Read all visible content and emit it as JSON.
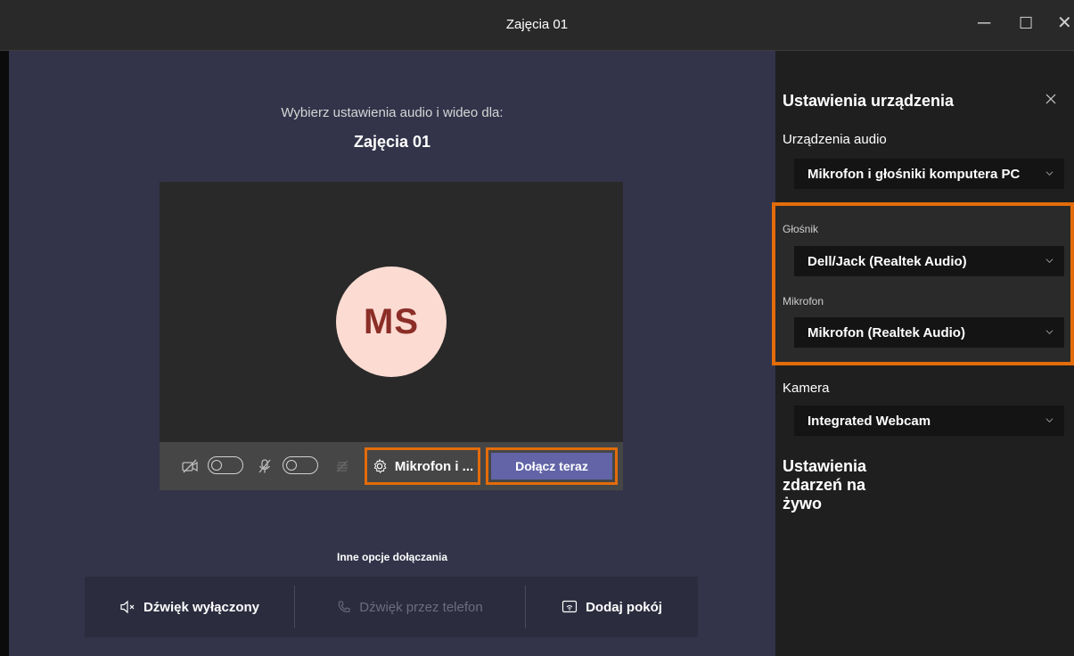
{
  "window": {
    "title": "Zajęcia 01",
    "minimize_glyph": "─",
    "maximize_glyph": "☐",
    "close_glyph": "✕"
  },
  "prejoin": {
    "subtitle": "Wybierz ustawienia audio i wideo dla:",
    "meeting_title": "Zajęcia 01",
    "avatar_initials": "MS",
    "device_button_label": "Mikrofon i ...",
    "join_button_label": "Dołącz teraz"
  },
  "other_options": {
    "label": "Inne opcje dołączania",
    "items": [
      {
        "label": "Dźwięk wyłączony",
        "icon": "speaker-muted-icon",
        "enabled": true
      },
      {
        "label": "Dźwięk przez telefon",
        "icon": "phone-icon",
        "enabled": false
      },
      {
        "label": "Dodaj pokój",
        "icon": "room-cast-icon",
        "enabled": true
      }
    ]
  },
  "settings": {
    "title": "Ustawienia urządzenia",
    "audio_devices_label": "Urządzenia audio",
    "audio_devices_value": "Mikrofon i głośniki komputera PC",
    "speaker_label": "Głośnik",
    "speaker_value": "Dell/Jack (Realtek Audio)",
    "mic_label": "Mikrofon",
    "mic_value": "Mikrofon (Realtek Audio)",
    "camera_label": "Kamera",
    "camera_value": "Integrated Webcam",
    "live_events_title": "Ustawienia zdarzeń na żywo"
  },
  "colors": {
    "highlight": "#e36c0a",
    "join_button": "#6264a7",
    "main_bg": "#33344a",
    "panel_bg": "#1f1f1f",
    "avatar_bg": "#fbdbd2",
    "avatar_text": "#8b2e27"
  },
  "toggles": {
    "camera_on": false,
    "mic_on": false
  }
}
